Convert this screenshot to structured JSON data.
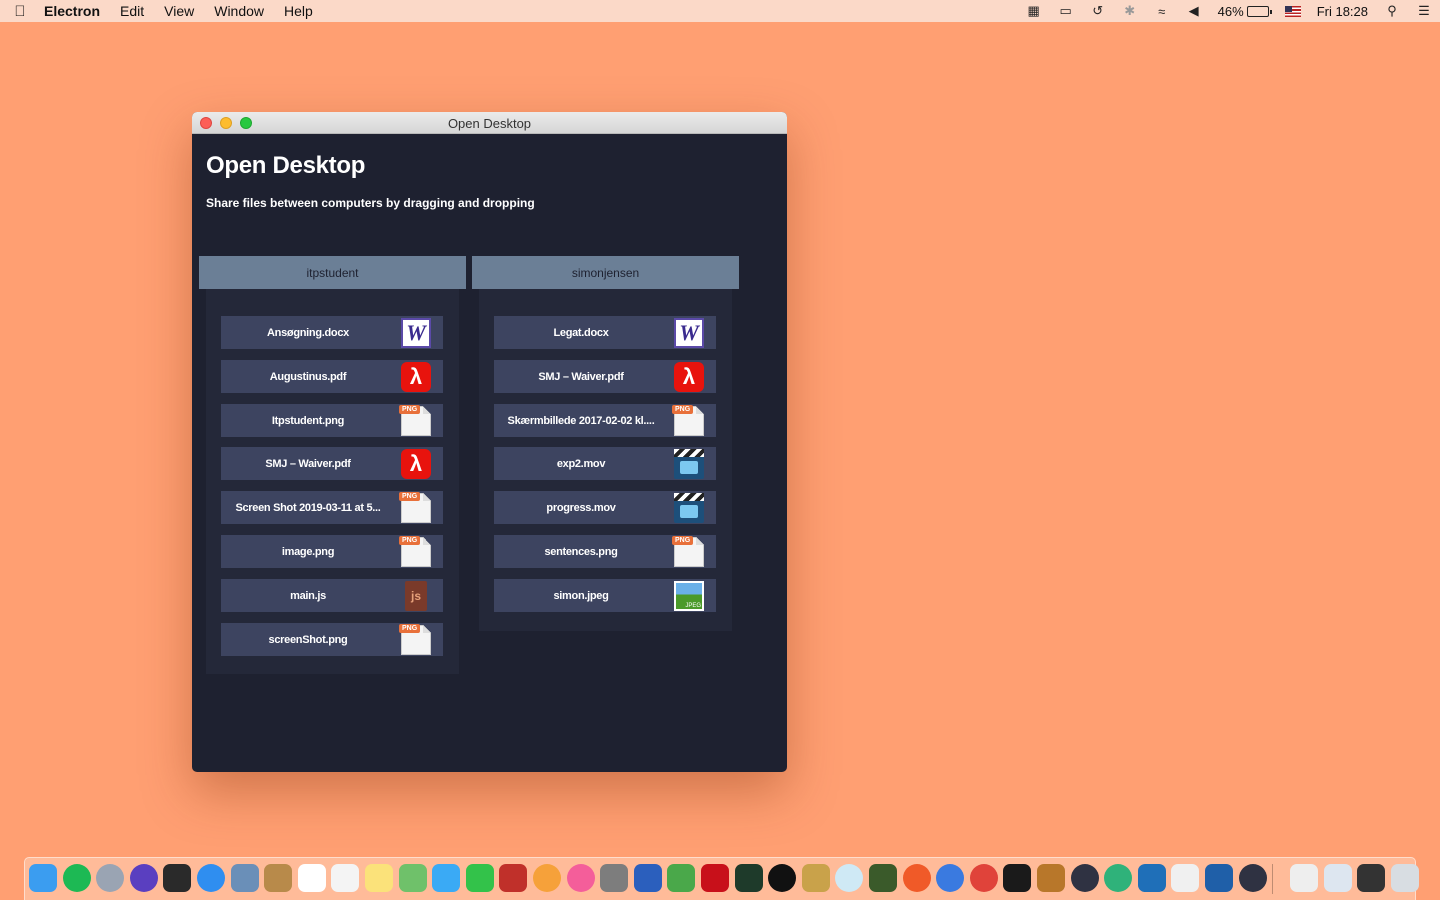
{
  "menubar": {
    "app_name": "Electron",
    "menus": [
      "Edit",
      "View",
      "Window",
      "Help"
    ],
    "battery": "46%",
    "clock": "Fri 18:28"
  },
  "window": {
    "title": "Open Desktop",
    "heading": "Open Desktop",
    "subtitle": "Share files between computers by dragging and dropping",
    "columns": [
      {
        "user": "itpstudent",
        "files": [
          {
            "name": "Ansøgning.docx",
            "type": "word"
          },
          {
            "name": "Augustinus.pdf",
            "type": "pdf"
          },
          {
            "name": "Itpstudent.png",
            "type": "png"
          },
          {
            "name": "SMJ – Waiver.pdf",
            "type": "pdf"
          },
          {
            "name": "Screen Shot 2019-03-11 at 5...",
            "type": "png"
          },
          {
            "name": "image.png",
            "type": "png"
          },
          {
            "name": "main.js",
            "type": "js"
          },
          {
            "name": "screenShot.png",
            "type": "png"
          }
        ]
      },
      {
        "user": "simonjensen",
        "files": [
          {
            "name": "Legat.docx",
            "type": "word"
          },
          {
            "name": "SMJ – Waiver.pdf",
            "type": "pdf"
          },
          {
            "name": "Skærmbillede 2017-02-02 kl....",
            "type": "png"
          },
          {
            "name": "exp2.mov",
            "type": "mov"
          },
          {
            "name": "progress.mov",
            "type": "mov"
          },
          {
            "name": "sentences.png",
            "type": "png"
          },
          {
            "name": "simon.jpeg",
            "type": "jpeg"
          }
        ]
      }
    ],
    "icon_labels": {
      "word": "W",
      "png": "PNG",
      "js": "js",
      "jpeg": "JPEG"
    }
  },
  "dock": {
    "apps": [
      {
        "name": "finder",
        "color": "#3b9df0"
      },
      {
        "name": "spotify",
        "color": "#1db954"
      },
      {
        "name": "launchpad",
        "color": "#9aa4b3"
      },
      {
        "name": "siri",
        "color": "#5a3fc0"
      },
      {
        "name": "dashboard",
        "color": "#2a2a2a"
      },
      {
        "name": "safari",
        "color": "#2f8ef0"
      },
      {
        "name": "preview",
        "color": "#6a8fb8"
      },
      {
        "name": "contacts",
        "color": "#b88a4a"
      },
      {
        "name": "calendar",
        "color": "#ffffff"
      },
      {
        "name": "reminders",
        "color": "#f4f4f4"
      },
      {
        "name": "notes",
        "color": "#fbe27a"
      },
      {
        "name": "maps",
        "color": "#6fc16a"
      },
      {
        "name": "messages",
        "color": "#3aaaf5"
      },
      {
        "name": "facetime",
        "color": "#33c24a"
      },
      {
        "name": "photo-booth",
        "color": "#c0302a"
      },
      {
        "name": "photos",
        "color": "#f6a13a"
      },
      {
        "name": "itunes",
        "color": "#f45e9a"
      },
      {
        "name": "system-preferences",
        "color": "#7d7d7d"
      },
      {
        "name": "word-app",
        "color": "#2b5fbd"
      },
      {
        "name": "sourcetree",
        "color": "#4aa84a"
      },
      {
        "name": "acrobat",
        "color": "#c8101a"
      },
      {
        "name": "activity-monitor",
        "color": "#1e3a2a"
      },
      {
        "name": "iterm",
        "color": "#111111"
      },
      {
        "name": "archive",
        "color": "#c9a24a"
      },
      {
        "name": "atom",
        "color": "#cfe9f5"
      },
      {
        "name": "automator",
        "color": "#3a5a2a"
      },
      {
        "name": "swift",
        "color": "#f05a28"
      },
      {
        "name": "proxy",
        "color": "#3a7ae0"
      },
      {
        "name": "chrome",
        "color": "#e0433a"
      },
      {
        "name": "terminal",
        "color": "#1a1a1a"
      },
      {
        "name": "sketch-like",
        "color": "#b8772a"
      },
      {
        "name": "electron-1",
        "color": "#2f3242"
      },
      {
        "name": "atom-green",
        "color": "#2fb27a"
      },
      {
        "name": "vscode",
        "color": "#1f6fb8"
      },
      {
        "name": "textedit",
        "color": "#f0f0f0"
      },
      {
        "name": "vscode-2",
        "color": "#1f5fa8"
      },
      {
        "name": "electron-2",
        "color": "#2f3242"
      },
      {
        "name": "documents",
        "color": "#eeeeee"
      },
      {
        "name": "screenshot-folder",
        "color": "#dde6f0"
      },
      {
        "name": "display",
        "color": "#333333"
      },
      {
        "name": "trash",
        "color": "#d8dde2"
      }
    ]
  }
}
